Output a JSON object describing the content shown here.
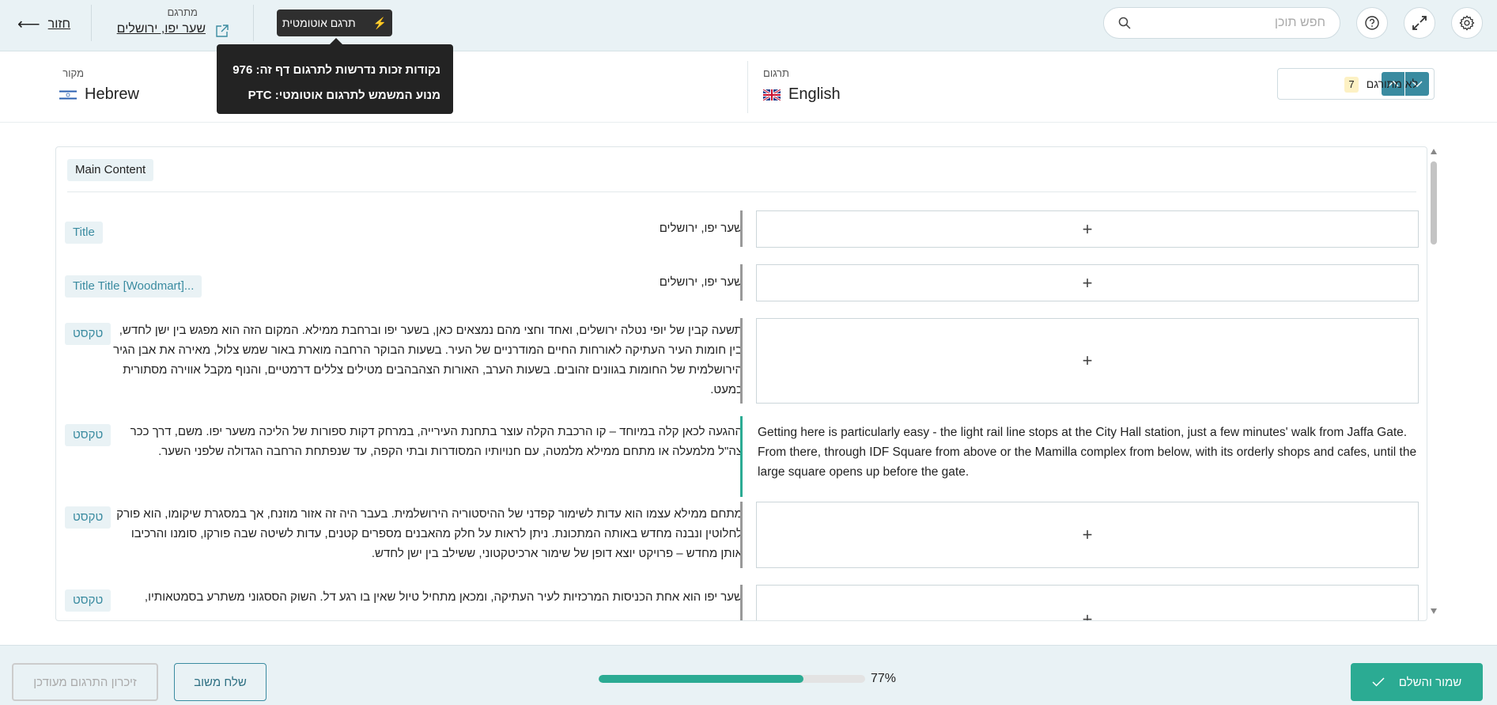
{
  "topbar": {
    "back_label": "חזור",
    "translator_label": "מתרגם",
    "page_title": "שער יפו, ירושלים",
    "auto_translate_label": "תרגם אוטומטית",
    "tooltip": {
      "credits_line": "נקודות זכות נדרשות לתרגום דף זה: 976",
      "engine_line": "מנוע המשמש לתרגום אוטומטי: PTC"
    },
    "search_placeholder": "חפש תוכן",
    "icons": [
      "help-icon",
      "expand-icon",
      "gear-icon"
    ]
  },
  "languages": {
    "source_label": "מקור",
    "source_name": "Hebrew",
    "target_label": "תרגום",
    "target_name": "English",
    "untranslated_label": "לא מתורגם",
    "untranslated_count": "7"
  },
  "content": {
    "section_label": "Main Content",
    "add_symbol": "+",
    "rows": [
      {
        "tag": "Title",
        "source": "שער יפו, ירושלים",
        "translation": ""
      },
      {
        "tag": "Title Title [Woodmart]...",
        "source": "שער יפו, ירושלים",
        "translation": ""
      },
      {
        "tag": "טקסט",
        "source": "תשעה קבין של יופי נטלה ירושלים, ואחד וחצי מהם נמצאים כאן, בשער יפו וברחבת ממילא. המקום הזה הוא מפגש בין ישן לחדש, בין חומות העיר העתיקה לאורחות החיים המודרניים של העיר. בשעות הבוקר הרחבה מוארת באור שמש צלול, מאירה את אבן הגיר הירושלמית של החומות בגוונים זהובים. בשעות הערב, האורות הצהבהבים מטילים צללים דרמטיים, והנוף מקבל אווירה מסתורית כמעט.",
        "translation": ""
      },
      {
        "tag": "טקסט",
        "source": "ההגעה לכאן קלה במיוחד – קו הרכבת הקלה עוצר בתחנת העירייה, במרחק דקות ספורות של הליכה משער יפו. משם, דרך ככר צה\"ל מלמעלה או מתחם ממילא מלמטה, עם חנויותיו המסודרות ובתי הקפה, עד שנפתחת הרחבה הגדולה שלפני השער.",
        "translation": "Getting here is particularly easy - the light rail line stops at the City Hall station, just a few minutes' walk from Jaffa Gate. From there, through IDF Square from above or the Mamilla complex from below, with its orderly shops and cafes, until the large square opens up before the gate."
      },
      {
        "tag": "טקסט",
        "source": "מתחם ממילא עצמו הוא עדות לשימור קפדני של ההיסטוריה הירושלמית. בעבר היה זה אזור מוזנח, אך במסגרת שיקומו, הוא פורק לחלוטין ונבנה מחדש באותה המתכונת. ניתן לראות על חלק מהאבנים מספרים קטנים, עדות לשיטה שבה פורקו, סומנו והרכיבו אותן מחדש – פרויקט יוצא דופן של שימור ארכיטקטוני, ששילב בין ישן לחדש.",
        "translation": ""
      },
      {
        "tag": "טקסט",
        "source": "שער יפו הוא אחת הכניסות המרכזיות לעיר העתיקה, ומכאן מתחיל טיול שאין בו רגע דל. השוק הססגוני משתרע בסמטאותיו,",
        "translation": ""
      }
    ]
  },
  "footer": {
    "memory_label": "זיכרון התרגום מעודכן",
    "feedback_label": "שלח משוב",
    "progress_percent": 77,
    "progress_text": "77%",
    "save_label": "שמור והשלם"
  },
  "colors": {
    "accent": "#2bab93",
    "teal": "#3a8ba0",
    "topbar_bg": "#e9f2f5"
  }
}
